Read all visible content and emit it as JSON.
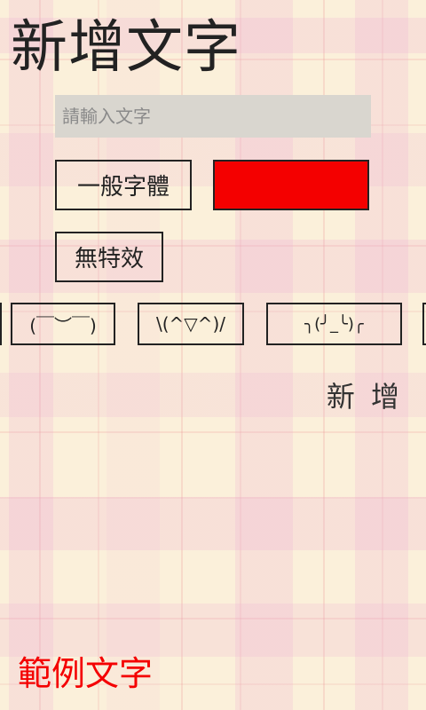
{
  "page": {
    "title": "新增文字"
  },
  "input": {
    "placeholder": "請輸入文字",
    "value": ""
  },
  "options": {
    "font_label": "一般字體",
    "color_value": "#f40000",
    "effect_label": "無特效"
  },
  "kaomoji": {
    "items": [
      "(￣︶￣)",
      "\\(^▽^)/",
      "╮(╯_╰)╭"
    ]
  },
  "actions": {
    "add_label": "新 增"
  },
  "preview": {
    "sample_text": "範例文字",
    "sample_color": "#f40000"
  },
  "colors": {
    "background": "#fbf0da",
    "plaid_accent": "#ecaad2",
    "text": "#222222"
  }
}
